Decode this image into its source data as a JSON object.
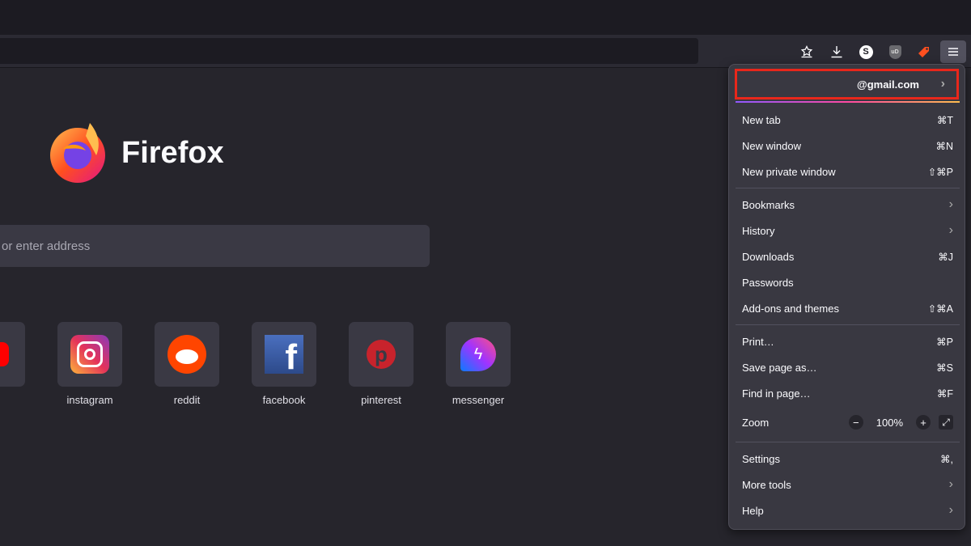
{
  "toolbar": {
    "icons": [
      "bookmark-star-icon",
      "downloads-icon",
      "extension-s-icon",
      "ublock-icon",
      "extension-tag-icon",
      "hamburger-menu-icon"
    ],
    "s_badge": "S",
    "ud_badge": "uD"
  },
  "newtab": {
    "brand": "Firefox",
    "search_placeholder": "or enter address",
    "tiles": [
      {
        "label": "be"
      },
      {
        "label": "instagram"
      },
      {
        "label": "reddit"
      },
      {
        "label": "facebook"
      },
      {
        "label": "pinterest"
      },
      {
        "label": "messenger"
      }
    ]
  },
  "menu": {
    "account": "@gmail.com",
    "items": [
      {
        "label": "New tab",
        "shortcut": "⌘T"
      },
      {
        "label": "New window",
        "shortcut": "⌘N"
      },
      {
        "label": "New private window",
        "shortcut": "⇧⌘P"
      },
      {
        "label": "Bookmarks"
      },
      {
        "label": "History"
      },
      {
        "label": "Downloads",
        "shortcut": "⌘J"
      },
      {
        "label": "Passwords"
      },
      {
        "label": "Add-ons and themes",
        "shortcut": "⇧⌘A"
      },
      {
        "label": "Print…",
        "shortcut": "⌘P"
      },
      {
        "label": "Save page as…",
        "shortcut": "⌘S"
      },
      {
        "label": "Find in page…",
        "shortcut": "⌘F"
      },
      {
        "label": "Zoom",
        "value": "100%"
      },
      {
        "label": "Settings",
        "shortcut": "⌘,"
      },
      {
        "label": "More tools"
      },
      {
        "label": "Help"
      }
    ]
  }
}
